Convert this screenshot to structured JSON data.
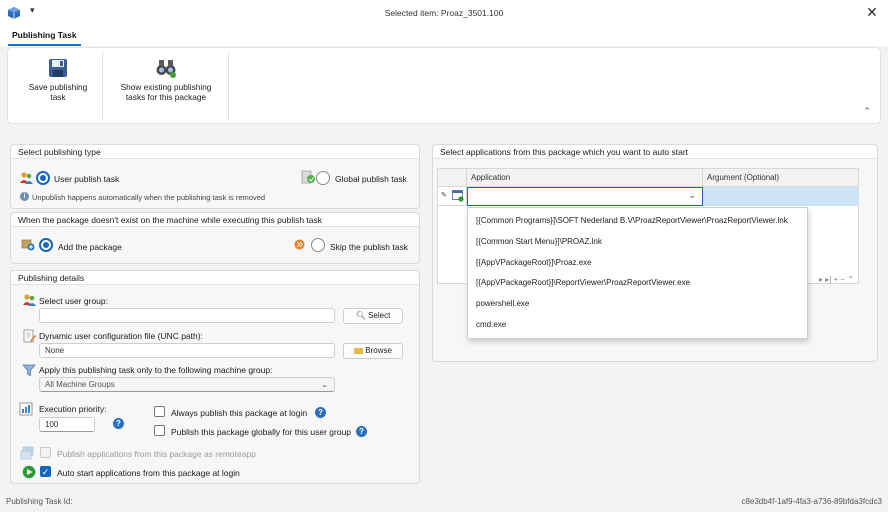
{
  "window": {
    "title": "Selected item: Proaz_3501.100",
    "menu_glyph": "▾",
    "close_glyph": "✕"
  },
  "tabs": {
    "active": "Publishing Task"
  },
  "ribbon": {
    "save_label": "Save publishing task",
    "show_label": "Show existing publishing tasks for this package",
    "collapse_glyph": "⌃"
  },
  "publish_type": {
    "header": "Select publishing type",
    "user_label": "User publish task",
    "global_label": "Global publish task",
    "selected": "user",
    "note": "Unpublish happens automatically when the publishing task is removed"
  },
  "missing_package": {
    "header": "When the package doesn't exist on the machine while executing this publish task",
    "add_label": "Add the package",
    "skip_label": "Skip the publish task",
    "selected": "add"
  },
  "details": {
    "header": "Publishing details",
    "user_group_label": "Select user group:",
    "user_group_value": "",
    "select_button": "Select",
    "config_label": "Dynamic user configuration file (UNC path):",
    "config_value": "None",
    "browse_button": "Browse",
    "machine_group_label": "Apply this publishing task only to the following machine group:",
    "machine_group_value": "All Machine Groups",
    "priority_label": "Execution priority:",
    "priority_value": "100",
    "always_publish_label": "Always publish this package at login",
    "always_publish_checked": false,
    "global_publish_label": "Publish this package globally for this user group",
    "global_publish_checked": false,
    "remoteapp_label": "Publish applications from this package as remoteapp",
    "remoteapp_checked": false,
    "remoteapp_enabled": false,
    "autostart_label": "Auto start applications from this package at login",
    "autostart_checked": true,
    "help_glyph": "?"
  },
  "apps": {
    "header": "Select applications from this package which you want to start",
    "header_full": "Select applications from this package which you want to auto start",
    "columns": [
      "Application",
      "Argument (Optional)"
    ],
    "row_application": "",
    "row_argument": "",
    "options": [
      "[{Common Programs}]\\SOFT Nederland B.V\\ProazReportViewer\\ProazReportViewer.lnk",
      "[{Common Start Menu}]\\PROAZ.lnk",
      "[{AppVPackageRoot}]\\Proaz.exe",
      "[{AppVPackageRoot}]\\ReportViewer\\ProazReportViewer.exe",
      "powershell.exe",
      "cmd.exe"
    ],
    "nav_glyphs": "▸ ▸| + − ⌃"
  },
  "status": {
    "task_id_label": "Publishing Task Id:",
    "task_id_value": "c8e3db4f-1af9-4fa3-a736-89bfda3fcdc3"
  }
}
